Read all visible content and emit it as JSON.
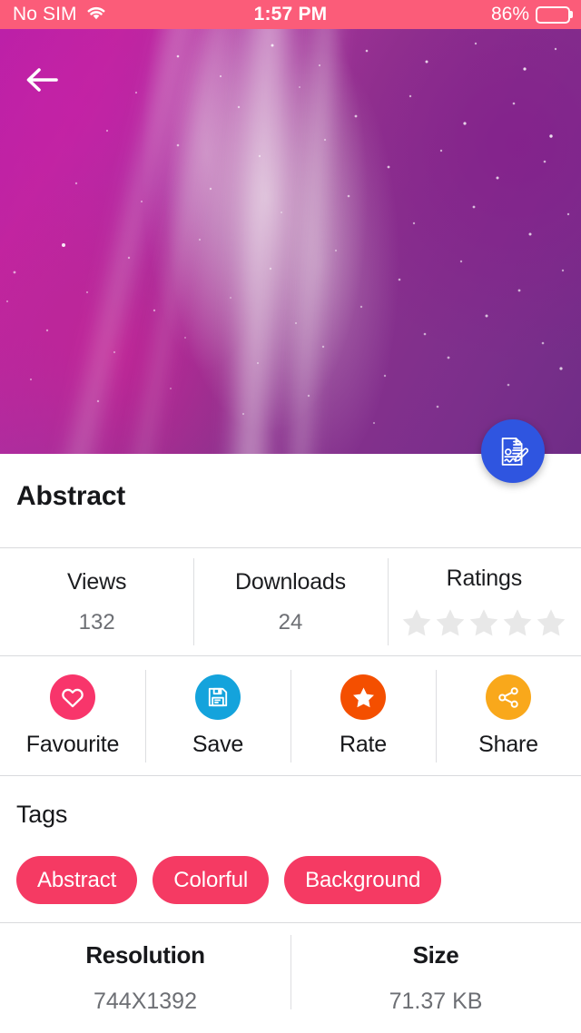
{
  "status_bar": {
    "carrier": "No SIM",
    "wifi_icon": "wifi-icon",
    "time": "1:57 PM",
    "battery_percent": "86%",
    "battery_level": 86,
    "background_color": "#fb5c79"
  },
  "hero": {
    "back_icon": "arrow-left-icon",
    "description": "Abstract magenta and purple aurora wallpaper with light beams and stars",
    "fab_icon": "document-signature-icon",
    "fab_color": "#2f55e0"
  },
  "detail": {
    "title": "Abstract"
  },
  "stats": [
    {
      "label": "Views",
      "value": "132",
      "type": "text"
    },
    {
      "label": "Downloads",
      "value": "24",
      "type": "text"
    },
    {
      "label": "Ratings",
      "value": "",
      "type": "stars",
      "stars_total": 5,
      "stars_filled": 0,
      "star_color": "#e8e8e8"
    }
  ],
  "actions": [
    {
      "label": "Favourite",
      "icon": "heart-icon",
      "color": "#f8356b"
    },
    {
      "label": "Save",
      "icon": "floppy-disk-icon",
      "color": "#14a3dc"
    },
    {
      "label": "Rate",
      "icon": "star-icon",
      "color": "#f44f00"
    },
    {
      "label": "Share",
      "icon": "share-icon",
      "color": "#f9a81b"
    }
  ],
  "tags": {
    "heading": "Tags",
    "items": [
      "Abstract",
      "Colorful",
      "Background"
    ],
    "chip_color": "#f53a63"
  },
  "meta": [
    {
      "label": "Resolution",
      "value": "744X1392"
    },
    {
      "label": "Size",
      "value": "71.37 KB"
    }
  ]
}
